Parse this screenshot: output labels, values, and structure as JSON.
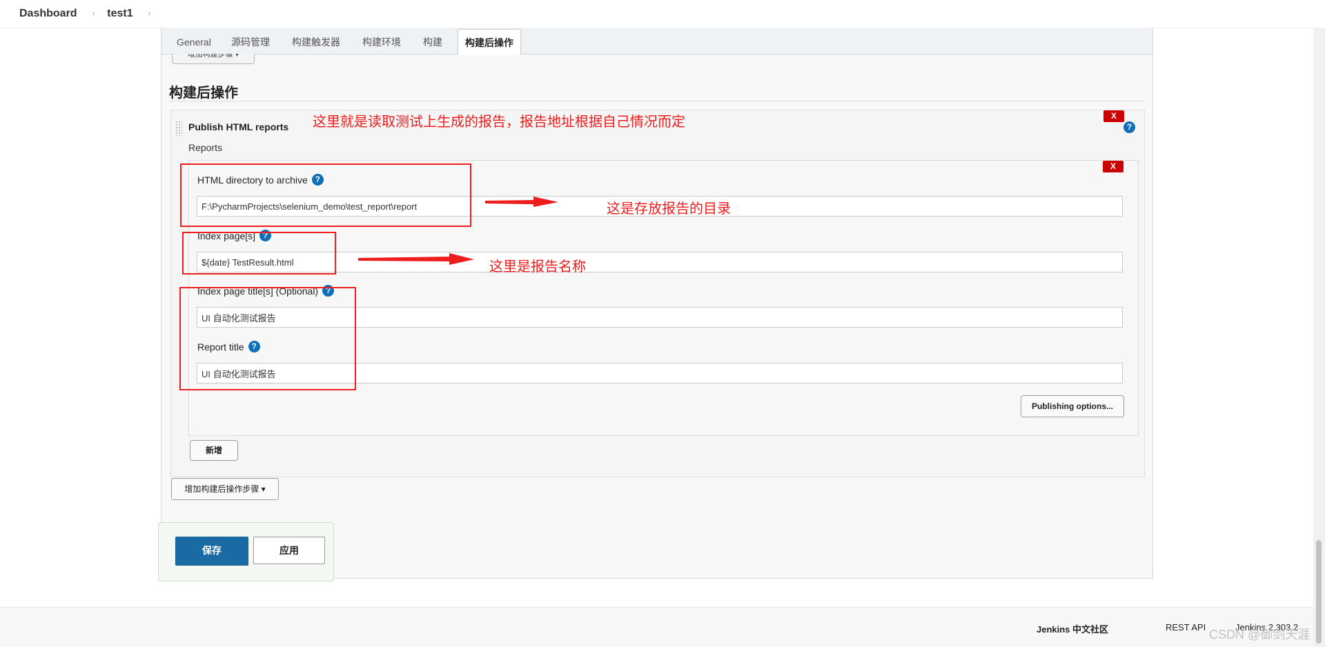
{
  "breadcrumb": {
    "dashboard": "Dashboard",
    "job": "test1",
    "separator": "›"
  },
  "tabs": [
    {
      "label": "General",
      "active": false
    },
    {
      "label": "源码管理",
      "active": false
    },
    {
      "label": "构建触发器",
      "active": false
    },
    {
      "label": "构建环境",
      "active": false
    },
    {
      "label": "构建",
      "active": false
    },
    {
      "label": "构建后操作",
      "active": true
    }
  ],
  "cut_button": "增加构建步骤 ▾",
  "section_title": "构建后操作",
  "publisher": {
    "title": "Publish HTML reports",
    "reports_label": "Reports",
    "delete_label": "X",
    "help": "?",
    "fields": {
      "html_dir": {
        "label": "HTML directory to archive",
        "value": "F:\\PycharmProjects\\selenium_demo\\test_report\\report"
      },
      "index_pages": {
        "label": "Index page[s]",
        "value": "${date} TestResult.html"
      },
      "index_titles": {
        "label": "Index page title[s] (Optional)",
        "value": "UI 自动化测试报告"
      },
      "report_title": {
        "label": "Report title",
        "value": "UI 自动化测试报告"
      }
    },
    "publishing_options": "Publishing options...",
    "add_new": "新增"
  },
  "add_post_build": "增加构建后操作步骤 ▾",
  "actions": {
    "save": "保存",
    "apply": "应用"
  },
  "footer": {
    "community": "Jenkins 中文社区",
    "rest_api": "REST API",
    "version": "Jenkins 2.303.2"
  },
  "watermark": "CSDN @御剑天涯",
  "annotations": {
    "note_top": "这里就是读取测试上生成的报告，报告地址根据自己情况而定",
    "note_dir": "这是存放报告的目录",
    "note_index": "这里是报告名称",
    "color": "#ee1c1c"
  },
  "colors": {
    "save_button": "#1a6ba3",
    "delete_button": "#cc0000",
    "help_icon": "#0e6fb8"
  }
}
